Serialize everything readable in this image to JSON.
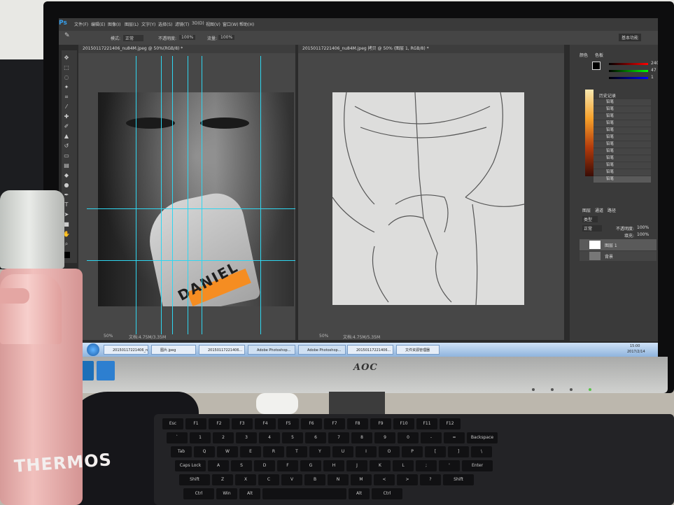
{
  "monitor": {
    "brand": "AOC"
  },
  "photoshop": {
    "logo": "Ps",
    "menu": [
      "文件(F)",
      "编辑(E)",
      "图像(I)",
      "图层(L)",
      "文字(Y)",
      "选择(S)",
      "滤镜(T)",
      "3D(D)",
      "视图(V)",
      "窗口(W)",
      "帮助(H)"
    ],
    "options": {
      "mode_label": "模式:",
      "mode_value": "正常",
      "opacity_label": "不透明度:",
      "opacity_value": "100%",
      "flow_label": "流量:",
      "flow_value": "100%",
      "workspace": "基本功能"
    },
    "left_doc": {
      "tab": "20150117221406_nu84M.jpeg @ 50%(RGB/8) *",
      "zoom": "50%",
      "status": "文档:4.75M/3.35M",
      "photo_text": "DANIEL"
    },
    "right_doc": {
      "tab": "20150117221406_nu84M.jpeg 拷贝 @ 50% (图层 1, RGB/8) *",
      "zoom": "50%",
      "status": "文档:4.75M/5.35M"
    },
    "color_panel": {
      "tabs": [
        "颜色",
        "色板"
      ],
      "r": "240",
      "g": "47",
      "b": "1"
    },
    "history_panel": {
      "title": "历史记录",
      "items": [
        "铅笔",
        "铅笔",
        "铅笔",
        "铅笔",
        "铅笔",
        "铅笔",
        "铅笔",
        "铅笔",
        "铅笔",
        "铅笔",
        "铅笔",
        "铅笔"
      ]
    },
    "layers_panel": {
      "tabs": [
        "图层",
        "通道",
        "路径"
      ],
      "kind": "类型",
      "blend": "正常",
      "opacity_label": "不透明度:",
      "opacity_value": "100%",
      "fill_label": "填充:",
      "fill_value": "100%",
      "layers": [
        "图层 1",
        "背景"
      ]
    }
  },
  "taskbar": {
    "tasks": [
      "20150117221406_nu84M.jpeg",
      "图片.jpeg",
      "20150117221406...",
      "Adobe Photoshop...",
      "Adobe Photoshop...",
      "20150117221406...",
      "文件资源管理器"
    ],
    "time": "15:00",
    "date": "2017/2/14"
  },
  "thermos": {
    "brand": "THERMOS"
  },
  "keyboard": {
    "rows": [
      [
        "Esc",
        "F1",
        "F2",
        "F3",
        "F4",
        "F5",
        "F6",
        "F7",
        "F8",
        "F9",
        "F10",
        "F11",
        "F12"
      ],
      [
        "`",
        "1",
        "2",
        "3",
        "4",
        "5",
        "6",
        "7",
        "8",
        "9",
        "0",
        "-",
        "=",
        "Backspace"
      ],
      [
        "Tab",
        "Q",
        "W",
        "E",
        "R",
        "T",
        "Y",
        "U",
        "I",
        "O",
        "P",
        "[",
        "]",
        "\\"
      ],
      [
        "Caps Lock",
        "A",
        "S",
        "D",
        "F",
        "G",
        "H",
        "J",
        "K",
        "L",
        ";",
        "'",
        "Enter"
      ],
      [
        "Shift",
        "Z",
        "X",
        "C",
        "V",
        "B",
        "N",
        "M",
        "<",
        ">",
        "?",
        "Shift"
      ],
      [
        "Ctrl",
        "Win",
        "Alt",
        "",
        "Alt",
        "Ctrl"
      ]
    ]
  },
  "colors": {
    "guide": "#2fd6f0",
    "band": "#f58d22",
    "ps_dark": "#2b2b2b"
  }
}
